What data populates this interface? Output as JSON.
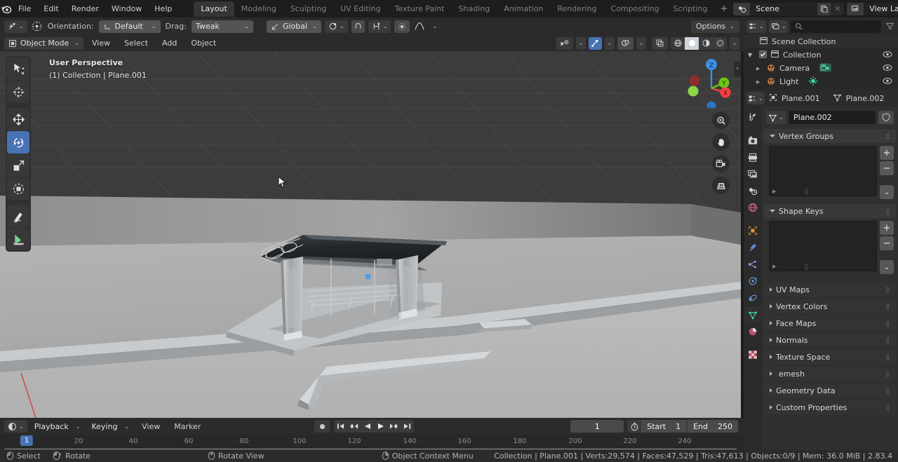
{
  "app": {
    "version": "2.83.4",
    "accent": "#4772b3",
    "bg": "#1d1d1d",
    "header_bg": "#2b2b2b",
    "viewport_bg": "#3c3c3c"
  },
  "topbar": {
    "logo_icon": "blender-logo-icon",
    "menus": [
      "File",
      "Edit",
      "Render",
      "Window",
      "Help"
    ],
    "workspace_tabs": [
      "Layout",
      "Modeling",
      "Sculpting",
      "UV Editing",
      "Texture Paint",
      "Shading",
      "Animation",
      "Rendering",
      "Compositing",
      "Scripting"
    ],
    "active_workspace": "Layout",
    "add_workspace_label": "+",
    "scene": {
      "icon": "scene-icon",
      "name": "Scene",
      "new_icon": "duplicate-icon",
      "unlink_icon": "x-icon"
    },
    "view_layer": {
      "icon": "view-layer-icon",
      "name": "View Layer",
      "new_icon": "duplicate-icon",
      "unlink_icon": "x-icon"
    }
  },
  "tool_header": {
    "snap_icon": "snap-magnet-icon",
    "proportional_icon": "proportional-edit-icon",
    "orientation_label": "Orientation:",
    "orientation_value": "Default",
    "orientation_icon": "orientation-icon",
    "drag_label": "Drag:",
    "drag_value": "Tweak",
    "transform_orientation_icon": "global-axis-icon",
    "transform_orientation_value": "Global",
    "snapping_icon": "snap-icon",
    "proportional_toggle_icon": "proportional-icon",
    "falloff_icon": "falloff-curve-icon",
    "mirror_icon": "mirror-icon",
    "options_label": "Options"
  },
  "viewport_header": {
    "mode": "Object Mode",
    "mode_icon": "object-mode-icon",
    "menus": [
      "View",
      "Select",
      "Add",
      "Object"
    ],
    "visibility_icon": "visibility-icon",
    "gizmo_icon": "gizmo-icon",
    "overlays_icon": "overlays-icon",
    "xray_icon": "xray-icon",
    "shading_modes": [
      "wireframe",
      "solid",
      "material-preview",
      "rendered"
    ],
    "active_shading": "solid"
  },
  "viewport": {
    "perspective_label": "User Perspective",
    "scene_label": "(1) Collection | Plane.001",
    "tools": [
      "tweak-select-tool",
      "cursor-tool",
      "move-tool",
      "rotate-tool",
      "scale-tool",
      "transform-tool",
      "annotate-tool",
      "measure-tool"
    ],
    "active_tool": "rotate-tool",
    "gizmo_axes": [
      "X",
      "Y",
      "Z"
    ],
    "gizmo_colors": {
      "x": "#fc4040",
      "y": "#6cc414",
      "z": "#3d8fe0"
    },
    "nav_buttons": [
      "zoom-icon",
      "pan-hand-icon",
      "camera-view-icon",
      "ortho-persp-icon"
    ],
    "collapse_icon": "chevron-left-icon",
    "cursor_icon": "mouse-pointer-icon",
    "scene_description": "Bus shelter model on a sidewalk with kerb and road"
  },
  "timeline": {
    "editor_icon": "timeline-editor-icon",
    "menus": [
      "Playback",
      "Keying",
      "View",
      "Marker"
    ],
    "transport": {
      "record_icon": "record-icon",
      "jump_start_icon": "jump-to-start-icon",
      "prev_keyframe_icon": "prev-keyframe-icon",
      "play_reverse_icon": "play-reverse-icon",
      "play_icon": "play-icon",
      "next_keyframe_icon": "next-keyframe-icon",
      "jump_end_icon": "jump-to-end-icon"
    },
    "current_frame": "1",
    "frame_icon": "stopwatch-icon",
    "start_label": "Start",
    "start_value": "1",
    "end_label": "End",
    "end_value": "250",
    "ruler_ticks": [
      "20",
      "40",
      "60",
      "80",
      "100",
      "120",
      "140",
      "160",
      "180",
      "200",
      "220",
      "240"
    ],
    "playhead_label": "1"
  },
  "outliner": {
    "display_mode_icon": "outliner-display-icon",
    "filter_id_icon": "filter-id-icon",
    "search_placeholder": "",
    "search_icon": "search-icon",
    "filter_icon": "funnel-icon",
    "rows": [
      {
        "label": "Scene Collection",
        "icon": "collection-icon",
        "indent": 0,
        "eye": false,
        "checkbox": false,
        "expand": false
      },
      {
        "label": "Collection",
        "icon": "collection-icon",
        "indent": 1,
        "eye": true,
        "checkbox": true,
        "expand": true
      },
      {
        "label": "Camera",
        "icon": "camera-obj-icon",
        "indent": 2,
        "eye": true,
        "checkbox": false,
        "expand": true,
        "data_icon": "camera-data-icon"
      },
      {
        "label": "Light",
        "icon": "light-obj-icon",
        "indent": 2,
        "eye": true,
        "checkbox": false,
        "expand": true,
        "data_icon": "light-data-icon"
      }
    ]
  },
  "properties": {
    "breadcrumb": {
      "editor_icon": "properties-editor-icon",
      "object_icon": "object-icon",
      "object_name": "Plane.001",
      "data_icon": "mesh-data-icon",
      "data_name": "Plane.002"
    },
    "tabs": [
      "tool-tab",
      "render-tab",
      "output-tab",
      "view-layer-tab",
      "scene-tab",
      "world-tab",
      "object-tab",
      "modifier-tab",
      "particles-tab",
      "physics-tab",
      "constraints-tab",
      "data-tab",
      "material-tab",
      "texture-tab"
    ],
    "active_tab": "data-tab",
    "id_field": {
      "icon": "mesh-data-icon",
      "name": "Plane.002",
      "shield_icon": "fake-user-icon"
    },
    "panels": [
      {
        "label": "Vertex Groups",
        "open": true,
        "type": "list"
      },
      {
        "label": "Shape Keys",
        "open": true,
        "type": "list"
      },
      {
        "label": "UV Maps",
        "open": false,
        "type": "simple"
      },
      {
        "label": "Vertex Colors",
        "open": false,
        "type": "simple"
      },
      {
        "label": "Face Maps",
        "open": false,
        "type": "simple"
      },
      {
        "label": "Normals",
        "open": false,
        "type": "simple"
      },
      {
        "label": "Texture Space",
        "open": false,
        "type": "simple"
      },
      {
        "label": "emesh",
        "open": false,
        "type": "simple"
      },
      {
        "label": "Geometry Data",
        "open": false,
        "type": "simple"
      },
      {
        "label": "Custom Properties",
        "open": false,
        "type": "simple"
      }
    ],
    "list_buttons": {
      "add": "+",
      "remove": "−",
      "menu": "⌄"
    }
  },
  "statusbar": {
    "hints": [
      {
        "icon": "mouse-left-icon",
        "label": "Select"
      },
      {
        "icon": "mouse-left-drag-icon",
        "label": "Rotate"
      },
      {
        "icon": "mouse-middle-icon",
        "label": "Rotate View"
      },
      {
        "icon": "mouse-right-icon",
        "label": "Object Context Menu"
      }
    ],
    "stats": "Collection | Plane.001 | Verts:29,574 | Faces:47,529 | Tris:47,613 | Objects:0/9 | Mem: 36.0 MiB | 2.83.4"
  }
}
